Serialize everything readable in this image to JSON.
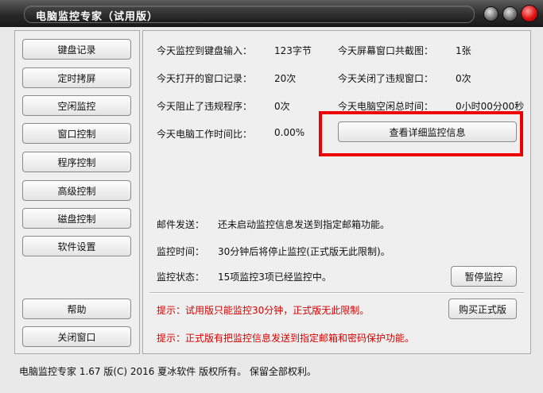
{
  "window": {
    "title": "电脑监控专家（试用版）"
  },
  "sidebar": {
    "items": [
      {
        "label": "键盘记录"
      },
      {
        "label": "定时拷屏"
      },
      {
        "label": "空闲监控"
      },
      {
        "label": "窗口控制"
      },
      {
        "label": "程序控制"
      },
      {
        "label": "高级控制"
      },
      {
        "label": "磁盘控制"
      },
      {
        "label": "软件设置"
      }
    ],
    "help_label": "帮助",
    "close_label": "关闭窗口"
  },
  "stats": {
    "keyboard_label": "今天监控到键盘输入：",
    "keyboard_value": "123字节",
    "screenshots_label": "今天屏幕窗口共截图：",
    "screenshots_value": "1张",
    "windows_opened_label": "今天打开的窗口记录：",
    "windows_opened_value": "20次",
    "windows_closed_label": "今天关闭了违规窗口：",
    "windows_closed_value": "0次",
    "blocked_label": "今天阻止了违规程序：",
    "blocked_value": "0次",
    "idle_label": "今天电脑空闲总时间：",
    "idle_value": "0小时00分00秒",
    "work_ratio_label": "今天电脑工作时间比：",
    "work_ratio_value": "0.00%"
  },
  "view_details_label": "查看详细监控信息",
  "status": {
    "email_label": "邮件发送：",
    "email_value": "还未启动监控信息发送到指定邮箱功能。",
    "time_label": "监控时间：",
    "time_value": "30分钟后将停止监控(正式版无此限制)。",
    "state_label": "监控状态：",
    "state_value": "15项监控3项已经监控中。",
    "pause_label": "暂停监控"
  },
  "notices": {
    "notice1": "提示：试用版只能监控30分钟，正式版无此限制。",
    "notice2": "提示：正式版有把监控信息发送到指定邮箱和密码保护功能。",
    "buy_label": "购买正式版"
  },
  "footer": "电脑监控专家  1.67  版(C)  2016  夏冰软件  版权所有。  保留全部权利。",
  "colors": {
    "accent_red": "#ee0000",
    "notice_red": "#d90000"
  }
}
